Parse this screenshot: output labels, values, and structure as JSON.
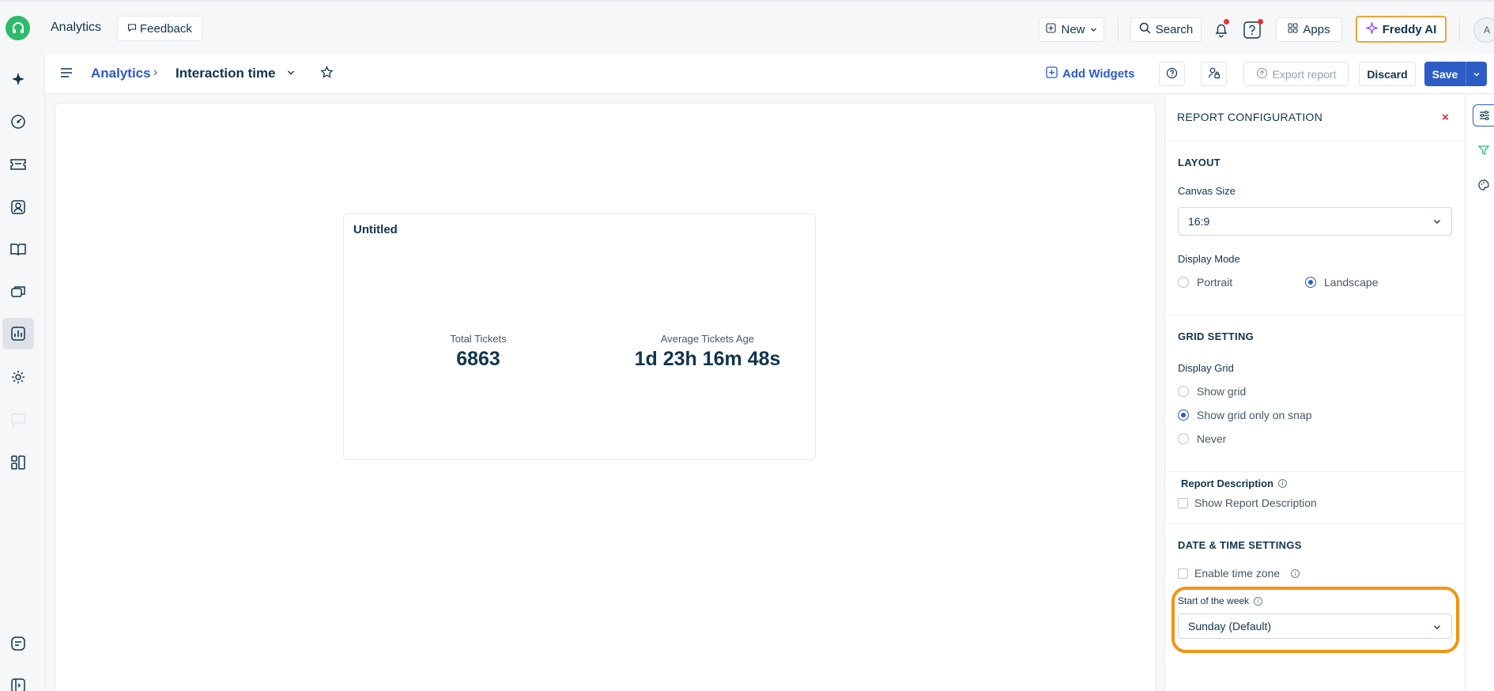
{
  "topbar": {
    "title": "Analytics",
    "feedback_label": "Feedback",
    "new_label": "New",
    "search_label": "Search",
    "apps_label": "Apps",
    "freddy_label": "Freddy AI",
    "avatar_initial": "A"
  },
  "header": {
    "breadcrumb_root": "Analytics",
    "breadcrumb_sep": "›",
    "report_name": "Interaction time",
    "add_widgets_label": "Add Widgets",
    "export_label": "Export report",
    "discard_label": "Discard",
    "save_label": "Save"
  },
  "widget": {
    "title": "Untitled",
    "metrics": [
      {
        "label": "Total Tickets",
        "value": "6863"
      },
      {
        "label": "Average Tickets Age",
        "value": "1d 23h 16m 48s"
      }
    ]
  },
  "panel": {
    "title": "REPORT CONFIGURATION",
    "close": "×",
    "layout": {
      "section": "LAYOUT",
      "canvas_size_label": "Canvas Size",
      "canvas_size_value": "16:9",
      "display_mode_label": "Display Mode",
      "portrait_label": "Portrait",
      "landscape_label": "Landscape"
    },
    "grid": {
      "section": "GRID SETTING",
      "display_grid_label": "Display Grid",
      "options": [
        "Show grid",
        "Show grid only on snap",
        "Never"
      ]
    },
    "description": {
      "label": "Report Description",
      "show_label": "Show Report Description"
    },
    "datetime": {
      "section": "DATE & TIME SETTINGS",
      "timezone_label": "Enable time zone",
      "start_week_label": "Start of the week",
      "start_week_value": "Sunday (Default)"
    }
  },
  "colors": {
    "accent": "#2c5cc5",
    "brand_green": "#2dba6a",
    "highlight": "#f39414",
    "close_red": "#d72d30"
  }
}
